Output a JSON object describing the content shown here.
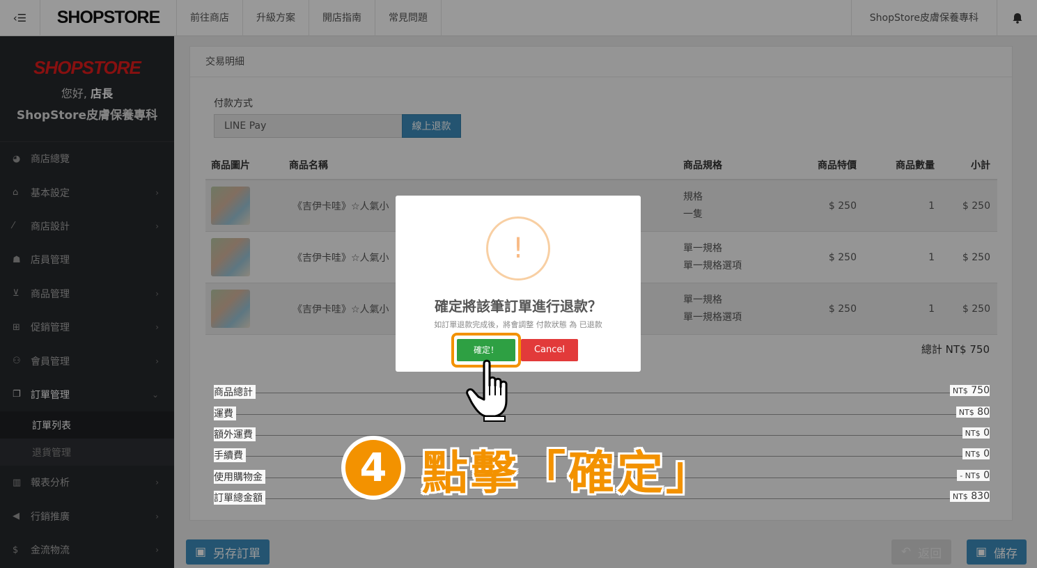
{
  "topbar": {
    "logo": "SHOPSTORE",
    "nav": [
      "前往商店",
      "升級方案",
      "開店指南",
      "常見問題"
    ],
    "user": "ShopStore皮膚保養專科"
  },
  "sidebar": {
    "logo": "SHOPSTORE",
    "greeting": "您好,",
    "role": "店長",
    "store": "ShopStore皮膚保養專科",
    "items": [
      {
        "label": "商店總覽",
        "icon": "dashboard-icon"
      },
      {
        "label": "基本設定",
        "icon": "bank-icon"
      },
      {
        "label": "商店設計",
        "icon": "wand-icon"
      },
      {
        "label": "店員管理",
        "icon": "user-lock-icon"
      },
      {
        "label": "商品管理",
        "icon": "cart-icon"
      },
      {
        "label": "促銷管理",
        "icon": "gift-icon"
      },
      {
        "label": "會員管理",
        "icon": "users-icon"
      },
      {
        "label": "訂單管理",
        "icon": "files-icon"
      },
      {
        "label": "報表分析",
        "icon": "bar-chart-icon"
      },
      {
        "label": "行銷推廣",
        "icon": "bullhorn-icon"
      },
      {
        "label": "金流物流",
        "icon": "dollar-icon"
      }
    ],
    "sub_items": [
      "訂單列表",
      "退貨管理"
    ]
  },
  "panel": {
    "title": "交易明細",
    "payment_label": "付款方式",
    "payment_value": "LINE Pay",
    "refund_button": "線上退款",
    "headers": [
      "商品圖片",
      "商品名稱",
      "商品規格",
      "商品特價",
      "商品數量",
      "小計"
    ],
    "rows": [
      {
        "name": "《吉伊卡哇》☆人氣小",
        "spec1": "規格",
        "spec2": "一隻",
        "price": "$ 250",
        "qty": "1",
        "subtotal": "$ 250"
      },
      {
        "name": "《吉伊卡哇》☆人氣小",
        "spec1": "單一規格",
        "spec2": "單一規格選項",
        "price": "$ 250",
        "qty": "1",
        "subtotal": "$ 250"
      },
      {
        "name": "《吉伊卡哇》☆人氣小",
        "spec1": "單一規格",
        "spec2": "單一規格選項",
        "price": "$ 250",
        "qty": "1",
        "subtotal": "$ 250"
      }
    ],
    "total": "總計 NT$ 750",
    "summary": [
      {
        "label": "商品總計",
        "prefix": "NT$",
        "value": "750"
      },
      {
        "label": "運費",
        "prefix": "NT$",
        "value": "80"
      },
      {
        "label": "額外運費",
        "prefix": "NT$",
        "value": "0"
      },
      {
        "label": "手續費",
        "prefix": "NT$",
        "value": "0"
      },
      {
        "label": "使用購物金",
        "prefix": "- NT$",
        "value": "0"
      },
      {
        "label": "訂單總金額",
        "prefix": "NT$",
        "value": "830"
      }
    ]
  },
  "bottom": {
    "save_as": "另存訂單",
    "back": "返回",
    "save": "儲存"
  },
  "modal": {
    "icon": "!",
    "title": "確定將該筆訂單進行退款？",
    "text": "如訂單退款完成後，將會調整 付款狀態 為 已退款",
    "confirm": "確定！",
    "cancel": "Cancel"
  },
  "annotation": {
    "step": "4",
    "text": "點擊「確定」"
  },
  "colors": {
    "accent_orange": "#f39200",
    "confirm_green": "#2ea043",
    "cancel_red": "#e23a3a",
    "primary_blue": "#3c8dbc"
  }
}
